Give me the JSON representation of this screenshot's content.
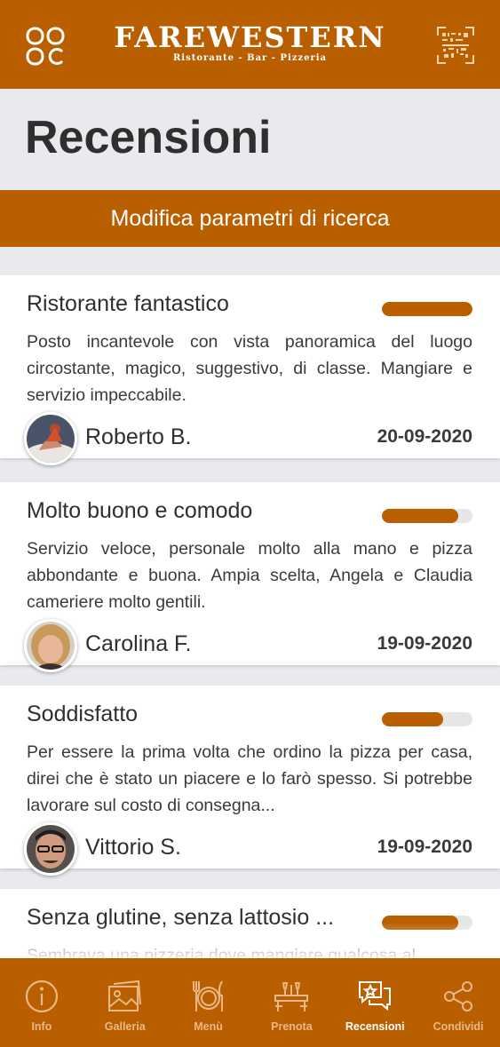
{
  "app": {
    "logo_name": "FAREWESTERN",
    "logo_subtitle": "Ristorante - Bar - Pizzeria",
    "left_icon": "grid-menu-icon",
    "right_icon": "qr-code-icon",
    "accent_color": "#b95f00"
  },
  "page": {
    "title": "Recensioni",
    "search_button_label": "Modifica parametri di ricerca"
  },
  "reviews": [
    {
      "title": "Ristorante fantastico",
      "rating_fraction": 1.0,
      "text": "Posto incantevole con vista panoramica del luogo circostante, magico, suggestivo, di classe. Mangiare e servizio impeccabile.",
      "author": "Roberto B.",
      "date": "20-09-2020"
    },
    {
      "title": "Molto buono e comodo",
      "rating_fraction": 0.84,
      "text": "Servizio veloce, personale molto alla mano e pizza abbondante e buona. Ampia scelta, Angela e Claudia cameriere molto gentili.",
      "author": "Carolina F.",
      "date": "19-09-2020"
    },
    {
      "title": "Soddisfatto",
      "rating_fraction": 0.68,
      "text": "Per essere la prima volta che ordino la pizza per casa, direi che è stato un piacere e lo farò spesso. Si potrebbe lavorare sul costo di consegna...",
      "author": "Vittorio S.",
      "date": "19-09-2020"
    },
    {
      "title": "Senza glutine, senza lattosio ...",
      "rating_fraction": 0.84,
      "text": "Sembrava una pizzeria dove mangiare qualcosa al",
      "author": "",
      "date": ""
    }
  ],
  "tabbar": {
    "items": [
      {
        "label": "Info",
        "icon": "info-icon",
        "active": false
      },
      {
        "label": "Galleria",
        "icon": "gallery-icon",
        "active": false
      },
      {
        "label": "Menù",
        "icon": "plate-cutlery-icon",
        "active": false
      },
      {
        "label": "Prenota",
        "icon": "table-booking-icon",
        "active": false
      },
      {
        "label": "Recensioni",
        "icon": "reviews-icon",
        "active": true
      },
      {
        "label": "Condividi",
        "icon": "share-icon",
        "active": false
      }
    ]
  }
}
